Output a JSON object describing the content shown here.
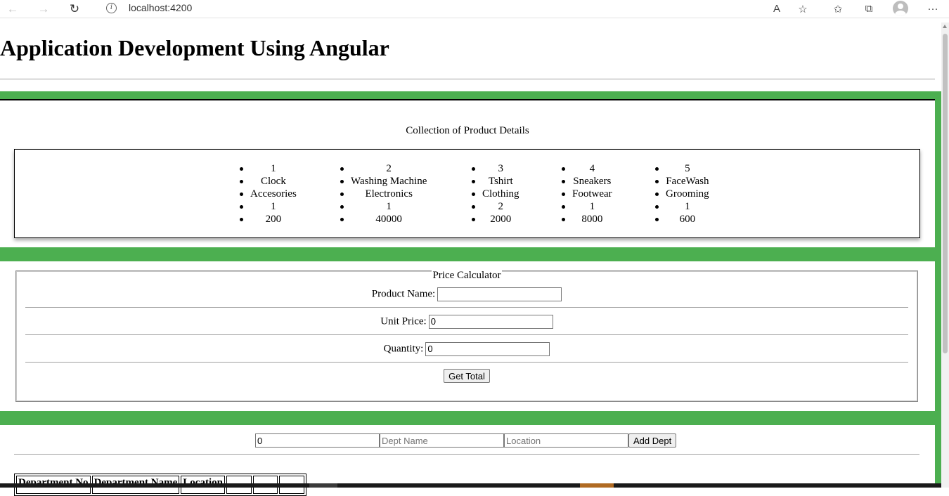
{
  "browser": {
    "url": "localhost:4200",
    "back_icon": "←",
    "forward_icon": "→",
    "reload_icon": "↻",
    "read_aloud_icon": "A",
    "favorite_add_icon": "☆",
    "favorites_icon": "✩",
    "collections_icon": "⧉",
    "more_icon": "···"
  },
  "page": {
    "title": "Application Development Using Angular"
  },
  "products": {
    "heading": "Collection of Product Details",
    "items": [
      {
        "id": "1",
        "name": "Clock",
        "category": "Accesories",
        "qty": "1",
        "price": "200"
      },
      {
        "id": "2",
        "name": "Washing Machine",
        "category": "Electronics",
        "qty": "1",
        "price": "40000"
      },
      {
        "id": "3",
        "name": "Tshirt",
        "category": "Clothing",
        "qty": "2",
        "price": "2000"
      },
      {
        "id": "4",
        "name": "Sneakers",
        "category": "Footwear",
        "qty": "1",
        "price": "8000"
      },
      {
        "id": "5",
        "name": "FaceWash",
        "category": "Grooming",
        "qty": "1",
        "price": "600"
      }
    ]
  },
  "calculator": {
    "legend": "Price Calculator",
    "product_name_label": "Product Name:",
    "product_name_value": "",
    "unit_price_label": "Unit Price:",
    "unit_price_value": "0",
    "quantity_label": "Quantity:",
    "quantity_value": "0",
    "get_total_label": "Get Total"
  },
  "dept_form": {
    "dept_no_value": "0",
    "dept_name_placeholder": "Dept Name",
    "location_placeholder": "Location",
    "add_label": "Add Dept"
  },
  "dept_table": {
    "headers": [
      "Department No",
      "Department Name",
      "Location",
      "",
      "",
      ""
    ]
  }
}
